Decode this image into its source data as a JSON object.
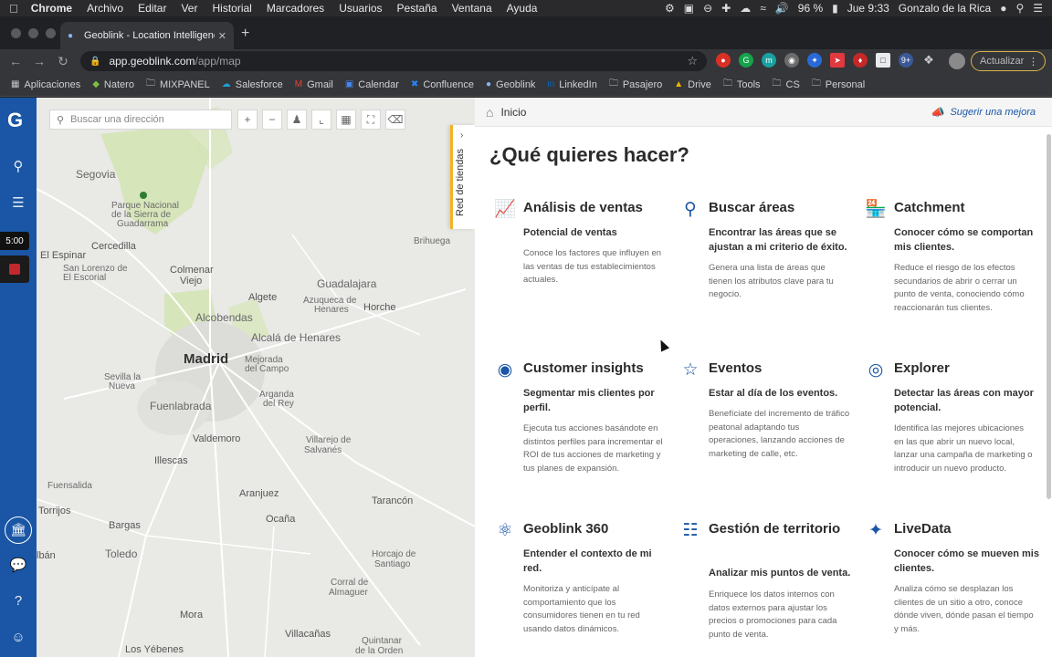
{
  "menubar": {
    "app": "Chrome",
    "items": [
      "Archivo",
      "Editar",
      "Ver",
      "Historial",
      "Marcadores",
      "Usuarios",
      "Pestaña",
      "Ventana",
      "Ayuda"
    ],
    "battery": "96 %",
    "clock": "Jue 9:33",
    "user": "Gonzalo de la Rica"
  },
  "browser": {
    "tab_title": "Geoblink - Location Intelligence",
    "url_domain": "app.geoblink.com",
    "url_path": "/app/map",
    "update_label": "Actualizar",
    "bookmarks": [
      "Aplicaciones",
      "Natero",
      "MIXPANEL",
      "Salesforce",
      "Gmail",
      "Calendar",
      "Confluence",
      "Geoblink",
      "LinkedIn",
      "Pasajero",
      "Drive",
      "Tools",
      "CS",
      "Personal"
    ]
  },
  "sidebar": {
    "timer": "5:00"
  },
  "map": {
    "search_placeholder": "Buscar una dirección",
    "places": {
      "segovia": "Segovia",
      "parque1": "Parque Nacional",
      "parque2": "de la Sierra de",
      "parque3": "Guadarrama",
      "cercedilla": "Cercedilla",
      "brihuega": "Brihuega",
      "espinar": "El Espinar",
      "colmenar1": "Colmenar",
      "colmenar2": "Viejo",
      "guadalajara": "Guadalajara",
      "algete": "Algete",
      "azuqueca1": "Azuqueca de",
      "azuqueca2": "Henares",
      "horche": "Horche",
      "slorenzo1": "San Lorenzo de",
      "slorenzo2": "El Escorial",
      "alcobendas": "Alcobendas",
      "alcala": "Alcalá de Henares",
      "madrid": "Madrid",
      "mejorada1": "Mejorada",
      "mejorada2": "del Campo",
      "sevilla1": "Sevilla la",
      "sevilla2": "Nueva",
      "fuenlabrada": "Fuenlabrada",
      "arganda1": "Arganda",
      "arganda2": "del Rey",
      "valdemoro": "Valdemoro",
      "villarejo1": "Villarejo de",
      "villarejo2": "Salvanés",
      "illescas": "Illescas",
      "fuensalida": "Fuensalida",
      "aranjuez": "Aranjuez",
      "tarancon": "Tarancón",
      "torrijos": "Torrijos",
      "ocana": "Ocaña",
      "bargas": "Bargas",
      "toledo": "Toledo",
      "horcajo1": "Horcajo de",
      "horcajo2": "Santiago",
      "corral1": "Corral de",
      "corral2": "Almaguer",
      "mora": "Mora",
      "villacanas": "Villacañas",
      "quintanar1": "Quintanar",
      "quintanar2": "de la Orden",
      "yebenes": "Los Yébenes",
      "talban": "lbán"
    }
  },
  "sidetab": {
    "label": "Red de tiendas"
  },
  "panel": {
    "breadcrumb": "Inicio",
    "suggest": "Sugerir una mejora",
    "heading": "¿Qué quieres hacer?",
    "cards": [
      {
        "title": "Análisis de ventas",
        "subtitle": "Potencial de ventas",
        "desc": "Conoce los factores que influyen en las ventas de tus establecimientos actuales.",
        "icon": "chart-line-icon"
      },
      {
        "title": "Buscar áreas",
        "subtitle": "Encontrar las áreas que se ajustan a mi criterio de éxito.",
        "desc": "Genera una lista de áreas que tienen los atributos clave para tu negocio.",
        "icon": "search-areas-icon"
      },
      {
        "title": "Catchment",
        "subtitle": "Conocer cómo se comportan mis clientes.",
        "desc": "Reduce el riesgo de los efectos secundarios de abrir o cerrar un punto de venta, conociendo cómo reaccionarán tus clientes.",
        "icon": "store-icon"
      },
      {
        "title": "Customer insights",
        "subtitle": "Segmentar mis clientes por perfil.",
        "desc": "Ejecuta tus acciones basándote en distintos perfiles para incrementar el ROI de tus acciones de marketing y tus planes de expansión.",
        "icon": "target-user-icon"
      },
      {
        "title": "Eventos",
        "subtitle": "Estar al día de los eventos.",
        "desc": "Benefíciate del incremento de tráfico peatonal adaptando tus operaciones, lanzando acciones de marketing de calle, etc.",
        "icon": "calendar-star-icon"
      },
      {
        "title": "Explorer",
        "subtitle": "Detectar las áreas con mayor potencial.",
        "desc": "Identifica las mejores ubicaciones en las que abrir un nuevo local, lanzar una campaña de marketing o introducir un nuevo producto.",
        "icon": "map-pin-icon"
      },
      {
        "title": "Geoblink 360",
        "subtitle": "Entender el contexto de mi red.",
        "desc": "Monitoriza y anticípate al comportamiento que los consumidores tienen en tu red usando datos dinámicos.",
        "icon": "network-icon"
      },
      {
        "title": "Gestión de territorio",
        "subtitle": "Analizar mis puntos de venta.",
        "desc": "Enriquece los datos internos con datos externos para ajustar los precios o promociones para cada punto de venta.",
        "icon": "territory-icon"
      },
      {
        "title": "LiveData",
        "subtitle": "Conocer cómo se mueven mis clientes.",
        "desc": "Analiza cómo se desplazan los clientes de un sitio a otro, conoce dónde viven, dónde pasan el tiempo y más.",
        "icon": "people-flow-icon"
      }
    ]
  }
}
